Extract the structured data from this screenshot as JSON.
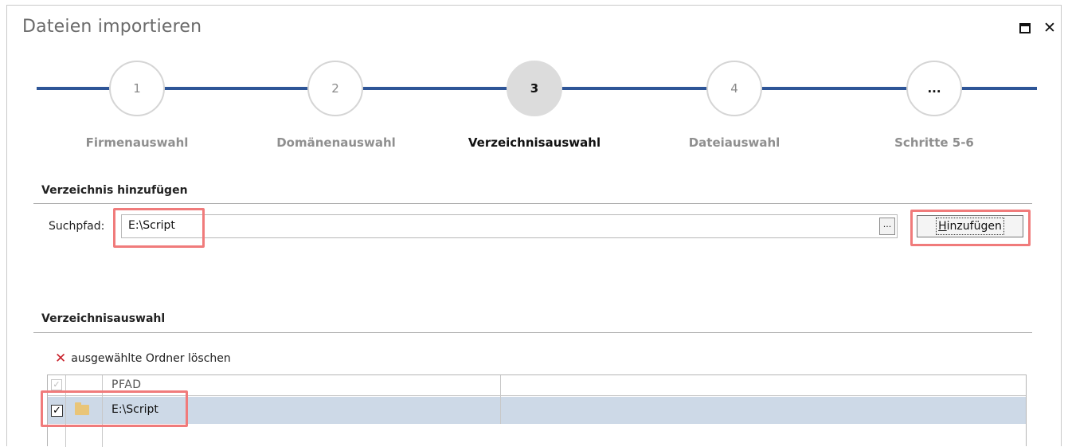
{
  "window": {
    "title": "Dateien importieren"
  },
  "steps": [
    {
      "number": "1",
      "label": "Firmenauswahl",
      "active": false
    },
    {
      "number": "2",
      "label": "Domänenauswahl",
      "active": false
    },
    {
      "number": "3",
      "label": "Verzeichnisauswahl",
      "active": true
    },
    {
      "number": "4",
      "label": "Dateiauswahl",
      "active": false
    },
    {
      "number": "...",
      "label": "Schritte 5-6",
      "active": false
    }
  ],
  "add_section": {
    "heading": "Verzeichnis hinzufügen",
    "search_label": "Suchpfad:",
    "search_value": "E:\\Script",
    "browse_label": "...",
    "add_button_label": "Hinzufügen"
  },
  "select_section": {
    "heading": "Verzeichnisauswahl",
    "delete_action": "ausgewählte Ordner löschen",
    "columns": [
      "PFAD"
    ],
    "rows": [
      {
        "checked": true,
        "path": "E:\\Script"
      }
    ]
  },
  "colors": {
    "accent": "#2e5597",
    "highlight": "#f07b7b",
    "selected_row": "#cdd9e7"
  }
}
